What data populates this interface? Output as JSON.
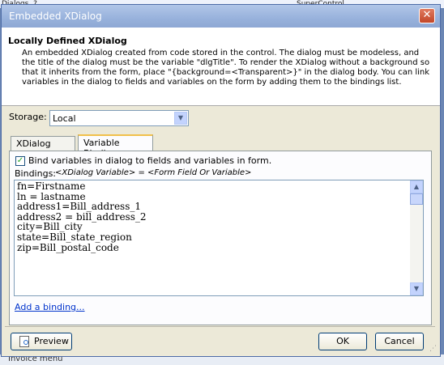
{
  "background": {
    "top_left_fragment": "Dialogs, ?",
    "top_right_fragment": "SuperControl",
    "bottom_fragment": "Invoice menu"
  },
  "window": {
    "title": "Embedded XDialog",
    "close_glyph": "✕"
  },
  "header": {
    "title": "Locally Defined XDialog",
    "description": "An embedded XDialog created from code stored in the control. The dialog must be modeless, and the title of the dialog must be the variable \"dlgTitle\". To render the XDialog without a background so that it inherits from the form, place \"{background=<Transparent>}\" in the dialog body. You can link variables in the dialog to fields and variables on the form by adding them to the bindings list."
  },
  "storage": {
    "label": "Storage:",
    "value": "Local"
  },
  "tabs": [
    {
      "label": "XDialog Code",
      "active": false
    },
    {
      "label": "Variable Binding",
      "active": true
    }
  ],
  "binding": {
    "checkbox_label": "Bind variables in dialog to fields and variables in form.",
    "checked": true,
    "bindings_label": "Bindings:",
    "bindings_hint": "<XDialog Variable> = <Form Field Or Variable>",
    "lines": [
      "fn=Firstname",
      "ln = lastname",
      "address1=Bill_address_1",
      "address2 = bill_address_2",
      "city=Bill_city",
      "state=Bill_state_region",
      "zip=Bill_postal_code"
    ],
    "add_link": "Add a binding..."
  },
  "buttons": {
    "preview": "Preview",
    "ok": "OK",
    "cancel": "Cancel"
  },
  "icons": {
    "close": "close-icon",
    "dropdown": "chevron-down-icon",
    "check": "checkmark-icon",
    "preview": "preview-icon"
  },
  "colors": {
    "titlebar": "#98b2dc",
    "link": "#0033cc",
    "tab_highlight": "#f1c04a"
  }
}
